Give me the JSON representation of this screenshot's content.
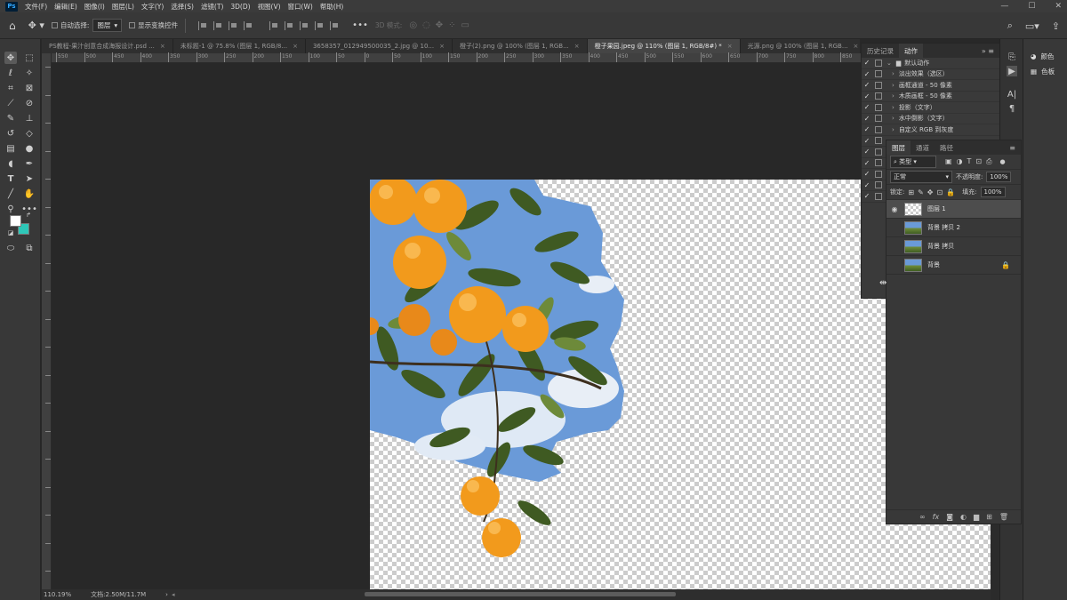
{
  "menubar": {
    "logo": "Ps",
    "items": [
      "文件(F)",
      "编辑(E)",
      "图像(I)",
      "图层(L)",
      "文字(Y)",
      "选择(S)",
      "滤镜(T)",
      "3D(D)",
      "视图(V)",
      "窗口(W)",
      "帮助(H)"
    ],
    "win_min": "—",
    "win_max": "☐",
    "win_close": "✕"
  },
  "optbar": {
    "auto_select_label": "自动选择:",
    "auto_select_value": "图层",
    "show_transform_label": "显示变换控件",
    "mode3d_label": "3D 模式:"
  },
  "tabs": [
    {
      "label": "PS教程-果汁创意合成海报设计.psd ...",
      "active": false
    },
    {
      "label": "未标题-1 @ 75.8% (图层 1, RGB/8...",
      "active": false
    },
    {
      "label": "3658357_012949500035_2.jpg @ 10...",
      "active": false
    },
    {
      "label": "橙子(2).png @ 100% (图层 1, RGB...",
      "active": false
    },
    {
      "label": "橙子果园.jpeg @ 110% (图层 1, RGB/8#) *",
      "active": true
    },
    {
      "label": "光源.png @ 100% (图层 1, RGB...",
      "active": false
    },
    {
      "label": "Nw",
      "active": false
    }
  ],
  "ruler_labels": [
    "550",
    "500",
    "450",
    "400",
    "350",
    "300",
    "250",
    "200",
    "150",
    "100",
    "50",
    "0",
    "50",
    "100",
    "150",
    "200",
    "250",
    "300",
    "350",
    "400",
    "450",
    "500",
    "550",
    "600",
    "650",
    "700",
    "750",
    "800",
    "850",
    "900",
    "950"
  ],
  "status": {
    "zoom": "110.19%",
    "doc": "文档:2.50M/11.7M",
    "arrow": "›"
  },
  "color_panel": {
    "color_label": "颜色",
    "swatch_label": "色板"
  },
  "actions_panel": {
    "tab_history": "历史记录",
    "tab_actions": "动作",
    "set_name": "默认动作",
    "items": [
      "淡出效果（选区）",
      "画框通道 - 50 像素",
      "木质画框 - 50 像素",
      "投影（文字）",
      "水中倒影（文字）",
      "自定义 RGB 到灰度"
    ]
  },
  "layers_panel": {
    "tab_layers": "图层",
    "tab_channels": "通道",
    "tab_paths": "路径",
    "filter_value": "类型",
    "blend_mode": "正常",
    "opacity_label": "不透明度:",
    "opacity_value": "100%",
    "lock_label": "锁定:",
    "fill_label": "填充:",
    "fill_value": "100%",
    "layers": [
      {
        "name": "图层 1",
        "selected": true,
        "visible": true,
        "thumb": "transparent"
      },
      {
        "name": "背景 拷贝 2",
        "selected": false,
        "visible": false,
        "thumb": "photo"
      },
      {
        "name": "背景 拷贝",
        "selected": false,
        "visible": false,
        "thumb": "photo"
      },
      {
        "name": "背景",
        "selected": false,
        "visible": false,
        "thumb": "photo",
        "locked": true
      }
    ]
  },
  "colors": {
    "fg": "#ffffff",
    "bg": "#2ec7b8",
    "sky": "#6a9ad8",
    "orange": "#f29a1c"
  }
}
